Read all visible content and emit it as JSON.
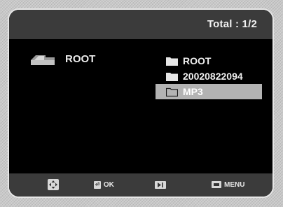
{
  "header": {
    "total": "Total : 1/2"
  },
  "current_folder": {
    "icon": "current-folder-icon",
    "label": "ROOT"
  },
  "folders": [
    {
      "icon": "folder-icon",
      "label": "ROOT",
      "selected": false
    },
    {
      "icon": "folder-icon",
      "label": "20020822094",
      "selected": false
    },
    {
      "icon": "folder-icon",
      "label": "MP3",
      "selected": true
    }
  ],
  "footer": {
    "nav_icon": "directional-pad-icon",
    "ok_icon": "enter-icon",
    "ok_label": "OK",
    "play_icon": "play-pause-icon",
    "menu_icon": "menu-icon",
    "menu_label": "MENU"
  },
  "colors": {
    "background": "#000000",
    "bar": "#3b3b3b",
    "selection": "#b3b3b3",
    "text": "#efefef"
  }
}
